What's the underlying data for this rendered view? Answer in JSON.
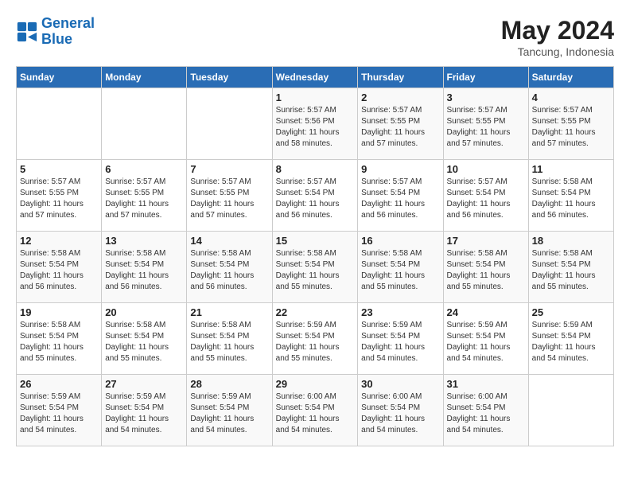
{
  "header": {
    "logo_line1": "General",
    "logo_line2": "Blue",
    "month_year": "May 2024",
    "location": "Tancung, Indonesia"
  },
  "weekdays": [
    "Sunday",
    "Monday",
    "Tuesday",
    "Wednesday",
    "Thursday",
    "Friday",
    "Saturday"
  ],
  "weeks": [
    [
      {
        "num": "",
        "info": ""
      },
      {
        "num": "",
        "info": ""
      },
      {
        "num": "",
        "info": ""
      },
      {
        "num": "1",
        "info": "Sunrise: 5:57 AM\nSunset: 5:56 PM\nDaylight: 11 hours\nand 58 minutes."
      },
      {
        "num": "2",
        "info": "Sunrise: 5:57 AM\nSunset: 5:55 PM\nDaylight: 11 hours\nand 57 minutes."
      },
      {
        "num": "3",
        "info": "Sunrise: 5:57 AM\nSunset: 5:55 PM\nDaylight: 11 hours\nand 57 minutes."
      },
      {
        "num": "4",
        "info": "Sunrise: 5:57 AM\nSunset: 5:55 PM\nDaylight: 11 hours\nand 57 minutes."
      }
    ],
    [
      {
        "num": "5",
        "info": "Sunrise: 5:57 AM\nSunset: 5:55 PM\nDaylight: 11 hours\nand 57 minutes."
      },
      {
        "num": "6",
        "info": "Sunrise: 5:57 AM\nSunset: 5:55 PM\nDaylight: 11 hours\nand 57 minutes."
      },
      {
        "num": "7",
        "info": "Sunrise: 5:57 AM\nSunset: 5:55 PM\nDaylight: 11 hours\nand 57 minutes."
      },
      {
        "num": "8",
        "info": "Sunrise: 5:57 AM\nSunset: 5:54 PM\nDaylight: 11 hours\nand 56 minutes."
      },
      {
        "num": "9",
        "info": "Sunrise: 5:57 AM\nSunset: 5:54 PM\nDaylight: 11 hours\nand 56 minutes."
      },
      {
        "num": "10",
        "info": "Sunrise: 5:57 AM\nSunset: 5:54 PM\nDaylight: 11 hours\nand 56 minutes."
      },
      {
        "num": "11",
        "info": "Sunrise: 5:58 AM\nSunset: 5:54 PM\nDaylight: 11 hours\nand 56 minutes."
      }
    ],
    [
      {
        "num": "12",
        "info": "Sunrise: 5:58 AM\nSunset: 5:54 PM\nDaylight: 11 hours\nand 56 minutes."
      },
      {
        "num": "13",
        "info": "Sunrise: 5:58 AM\nSunset: 5:54 PM\nDaylight: 11 hours\nand 56 minutes."
      },
      {
        "num": "14",
        "info": "Sunrise: 5:58 AM\nSunset: 5:54 PM\nDaylight: 11 hours\nand 56 minutes."
      },
      {
        "num": "15",
        "info": "Sunrise: 5:58 AM\nSunset: 5:54 PM\nDaylight: 11 hours\nand 55 minutes."
      },
      {
        "num": "16",
        "info": "Sunrise: 5:58 AM\nSunset: 5:54 PM\nDaylight: 11 hours\nand 55 minutes."
      },
      {
        "num": "17",
        "info": "Sunrise: 5:58 AM\nSunset: 5:54 PM\nDaylight: 11 hours\nand 55 minutes."
      },
      {
        "num": "18",
        "info": "Sunrise: 5:58 AM\nSunset: 5:54 PM\nDaylight: 11 hours\nand 55 minutes."
      }
    ],
    [
      {
        "num": "19",
        "info": "Sunrise: 5:58 AM\nSunset: 5:54 PM\nDaylight: 11 hours\nand 55 minutes."
      },
      {
        "num": "20",
        "info": "Sunrise: 5:58 AM\nSunset: 5:54 PM\nDaylight: 11 hours\nand 55 minutes."
      },
      {
        "num": "21",
        "info": "Sunrise: 5:58 AM\nSunset: 5:54 PM\nDaylight: 11 hours\nand 55 minutes."
      },
      {
        "num": "22",
        "info": "Sunrise: 5:59 AM\nSunset: 5:54 PM\nDaylight: 11 hours\nand 55 minutes."
      },
      {
        "num": "23",
        "info": "Sunrise: 5:59 AM\nSunset: 5:54 PM\nDaylight: 11 hours\nand 54 minutes."
      },
      {
        "num": "24",
        "info": "Sunrise: 5:59 AM\nSunset: 5:54 PM\nDaylight: 11 hours\nand 54 minutes."
      },
      {
        "num": "25",
        "info": "Sunrise: 5:59 AM\nSunset: 5:54 PM\nDaylight: 11 hours\nand 54 minutes."
      }
    ],
    [
      {
        "num": "26",
        "info": "Sunrise: 5:59 AM\nSunset: 5:54 PM\nDaylight: 11 hours\nand 54 minutes."
      },
      {
        "num": "27",
        "info": "Sunrise: 5:59 AM\nSunset: 5:54 PM\nDaylight: 11 hours\nand 54 minutes."
      },
      {
        "num": "28",
        "info": "Sunrise: 5:59 AM\nSunset: 5:54 PM\nDaylight: 11 hours\nand 54 minutes."
      },
      {
        "num": "29",
        "info": "Sunrise: 6:00 AM\nSunset: 5:54 PM\nDaylight: 11 hours\nand 54 minutes."
      },
      {
        "num": "30",
        "info": "Sunrise: 6:00 AM\nSunset: 5:54 PM\nDaylight: 11 hours\nand 54 minutes."
      },
      {
        "num": "31",
        "info": "Sunrise: 6:00 AM\nSunset: 5:54 PM\nDaylight: 11 hours\nand 54 minutes."
      },
      {
        "num": "",
        "info": ""
      }
    ]
  ]
}
